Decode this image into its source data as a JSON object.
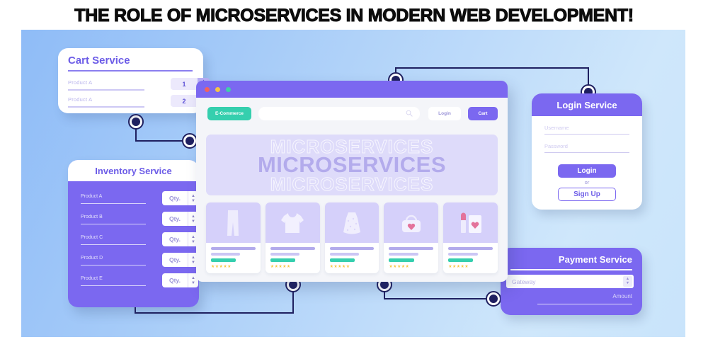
{
  "title": "THE ROLE OF MICROSERVICES IN MODERN WEB DEVELOPMENT!",
  "colors": {
    "purple": "#7b68f0",
    "purple_dark": "#6c5ce7",
    "teal": "#35cfae",
    "navy": "#1f2060",
    "star": "#f7c948",
    "canvas_blue": "#a4caf8"
  },
  "cart_service": {
    "title": "Cart Service",
    "rows": [
      {
        "label": "Product A",
        "qty": "1"
      },
      {
        "label": "Product A",
        "qty": "2"
      }
    ]
  },
  "inventory_service": {
    "title": "Inventory Service",
    "rows": [
      {
        "label": "Product A",
        "qty": "Qty."
      },
      {
        "label": "Product B",
        "qty": "Qty."
      },
      {
        "label": "Product C",
        "qty": "Qty."
      },
      {
        "label": "Product D",
        "qty": "Qty."
      },
      {
        "label": "Product E",
        "qty": "Qty."
      }
    ]
  },
  "login_service": {
    "title": "Login Service",
    "username_placeholder": "Username",
    "password_placeholder": "Password",
    "login_button": "Login",
    "or_text": "or",
    "signup_button": "Sign Up"
  },
  "payment_service": {
    "title": "Payment Service",
    "gateway_placeholder": "Gateway",
    "amount_label": "Amount"
  },
  "browser": {
    "brand_button": "E-Commerce",
    "search_placeholder": "",
    "login_button": "Login",
    "cart_button": "Cart",
    "hero_text": "MICROSERVICES",
    "products": [
      {
        "icon": "pants-icon",
        "stars": "★★★★★"
      },
      {
        "icon": "tshirt-icon",
        "stars": "★★★★★"
      },
      {
        "icon": "dress-icon",
        "stars": "★★★★★"
      },
      {
        "icon": "handbag-icon",
        "stars": "★★★★★"
      },
      {
        "icon": "cosmetics-icon",
        "stars": "★★★★★"
      }
    ]
  }
}
